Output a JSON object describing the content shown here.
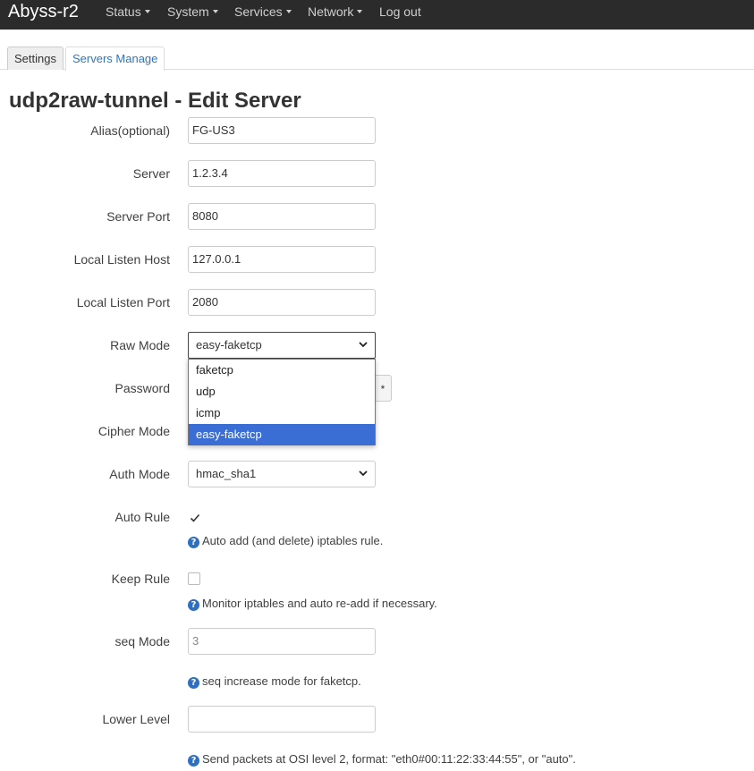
{
  "app": {
    "brand": "Abyss-r2",
    "menu": [
      "Status",
      "System",
      "Services",
      "Network",
      "Log out"
    ]
  },
  "tabs": [
    "Settings",
    "Servers Manage"
  ],
  "page": {
    "title": "udp2raw-tunnel - Edit Server"
  },
  "form": {
    "alias": {
      "label": "Alias(optional)",
      "value": "FG-US3"
    },
    "server": {
      "label": "Server",
      "value": "1.2.3.4"
    },
    "server_port": {
      "label": "Server Port",
      "value": "8080"
    },
    "local_host": {
      "label": "Local Listen Host",
      "value": "127.0.0.1"
    },
    "local_port": {
      "label": "Local Listen Port",
      "value": "2080"
    },
    "raw_mode": {
      "label": "Raw Mode",
      "value": "easy-faketcp",
      "options": [
        "faketcp",
        "udp",
        "icmp",
        "easy-faketcp"
      ]
    },
    "password": {
      "label": "Password",
      "reveal": "*"
    },
    "cipher_mode": {
      "label": "Cipher Mode"
    },
    "auth_mode": {
      "label": "Auth Mode",
      "value": "hmac_sha1"
    },
    "auto_rule": {
      "label": "Auto Rule",
      "checked": true,
      "hint": "Auto add (and delete) iptables rule."
    },
    "keep_rule": {
      "label": "Keep Rule",
      "checked": false,
      "hint": "Monitor iptables and auto re-add if necessary."
    },
    "seq_mode": {
      "label": "seq Mode",
      "placeholder": "3",
      "hint": "seq increase mode for faketcp."
    },
    "lower_level": {
      "label": "Lower Level",
      "value": "",
      "hint": "Send packets at OSI level 2, format: \"eth0#00:11:22:33:44:55\", or \"auto\"."
    }
  },
  "colors": {
    "navbar": "#2b2b2b",
    "accent": "#2f74c0",
    "selected_option": "#3a6ed4"
  }
}
